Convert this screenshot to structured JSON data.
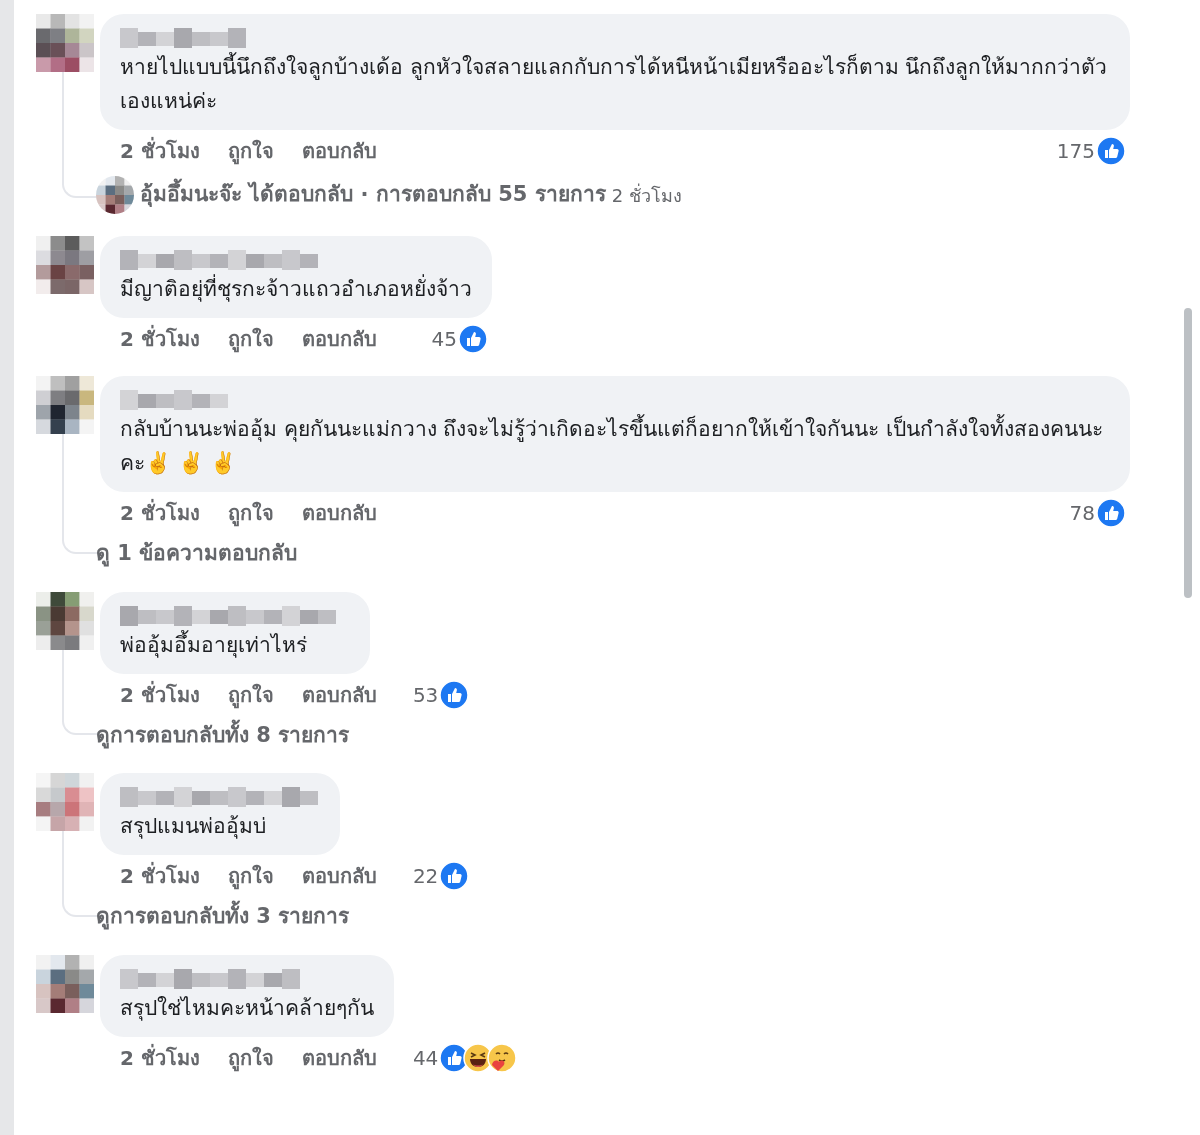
{
  "comments": [
    {
      "text": "หายไปแบบนี้นึกถึงใจลูกบ้างเด้อ ลูกหัวใจสลายแลกกับการได้หนีหน้าเมียหรืออะไรก็ตาม นึกถึงลูกให้มากกว่าตัวเองแหน่ค่ะ",
      "time": "2 ชั่วโมง",
      "like_label": "ถูกใจ",
      "reply_label": "ตอบกลับ",
      "reaction_count": "175",
      "reactions": [
        {
          "kind": "like"
        }
      ],
      "replies": {
        "kind": "replied_by",
        "text": "อุ้มอึ้มนะจ๊ะ ได้ตอบกลับ · การตอบกลับ 55 รายการ",
        "time": "2 ชั่วโมง"
      }
    },
    {
      "text": "มีญาติอยุ่ที่ชุรกะจ้าวแถวอำเภอหยั่งจ้าว",
      "time": "2 ชั่วโมง",
      "like_label": "ถูกใจ",
      "reply_label": "ตอบกลับ",
      "reaction_count": "45",
      "reactions": [
        {
          "kind": "like"
        }
      ]
    },
    {
      "text": "กลับบ้านนะพ่ออุ้ม คุยกันนะแม่กวาง ถึงจะไม่รู้ว่าเกิดอะไรขึ้นแต่ก็อยากให้เข้าใจกันนะ เป็นกำลังใจทั้งสองคนนะคะ✌️ ✌️ ✌️",
      "time": "2 ชั่วโมง",
      "like_label": "ถูกใจ",
      "reply_label": "ตอบกลับ",
      "reaction_count": "78",
      "reactions": [
        {
          "kind": "like"
        }
      ],
      "replies": {
        "kind": "view_more",
        "text": "ดู 1 ข้อความตอบกลับ"
      }
    },
    {
      "text": "พ่ออุ้มอึ้มอายุเท่าไหร่",
      "time": "2 ชั่วโมง",
      "like_label": "ถูกใจ",
      "reply_label": "ตอบกลับ",
      "reaction_count": "53",
      "reactions": [
        {
          "kind": "like"
        }
      ],
      "replies": {
        "kind": "view_more",
        "text": "ดูการตอบกลับทั้ง 8 รายการ"
      }
    },
    {
      "text": "สรุปแมนพ่ออุ้มบ่",
      "time": "2 ชั่วโมง",
      "like_label": "ถูกใจ",
      "reply_label": "ตอบกลับ",
      "reaction_count": "22",
      "reactions": [
        {
          "kind": "like"
        }
      ],
      "replies": {
        "kind": "view_more",
        "text": "ดูการตอบกลับทั้ง 3 รายการ"
      }
    },
    {
      "text": "สรุปใช่ไหมคะหน้าคล้ายๆกัน",
      "time": "2 ชั่วโมง",
      "like_label": "ถูกใจ",
      "reply_label": "ตอบกลับ",
      "reaction_count": "44",
      "reactions": [
        {
          "kind": "like"
        },
        {
          "kind": "haha"
        },
        {
          "kind": "care"
        }
      ]
    }
  ]
}
